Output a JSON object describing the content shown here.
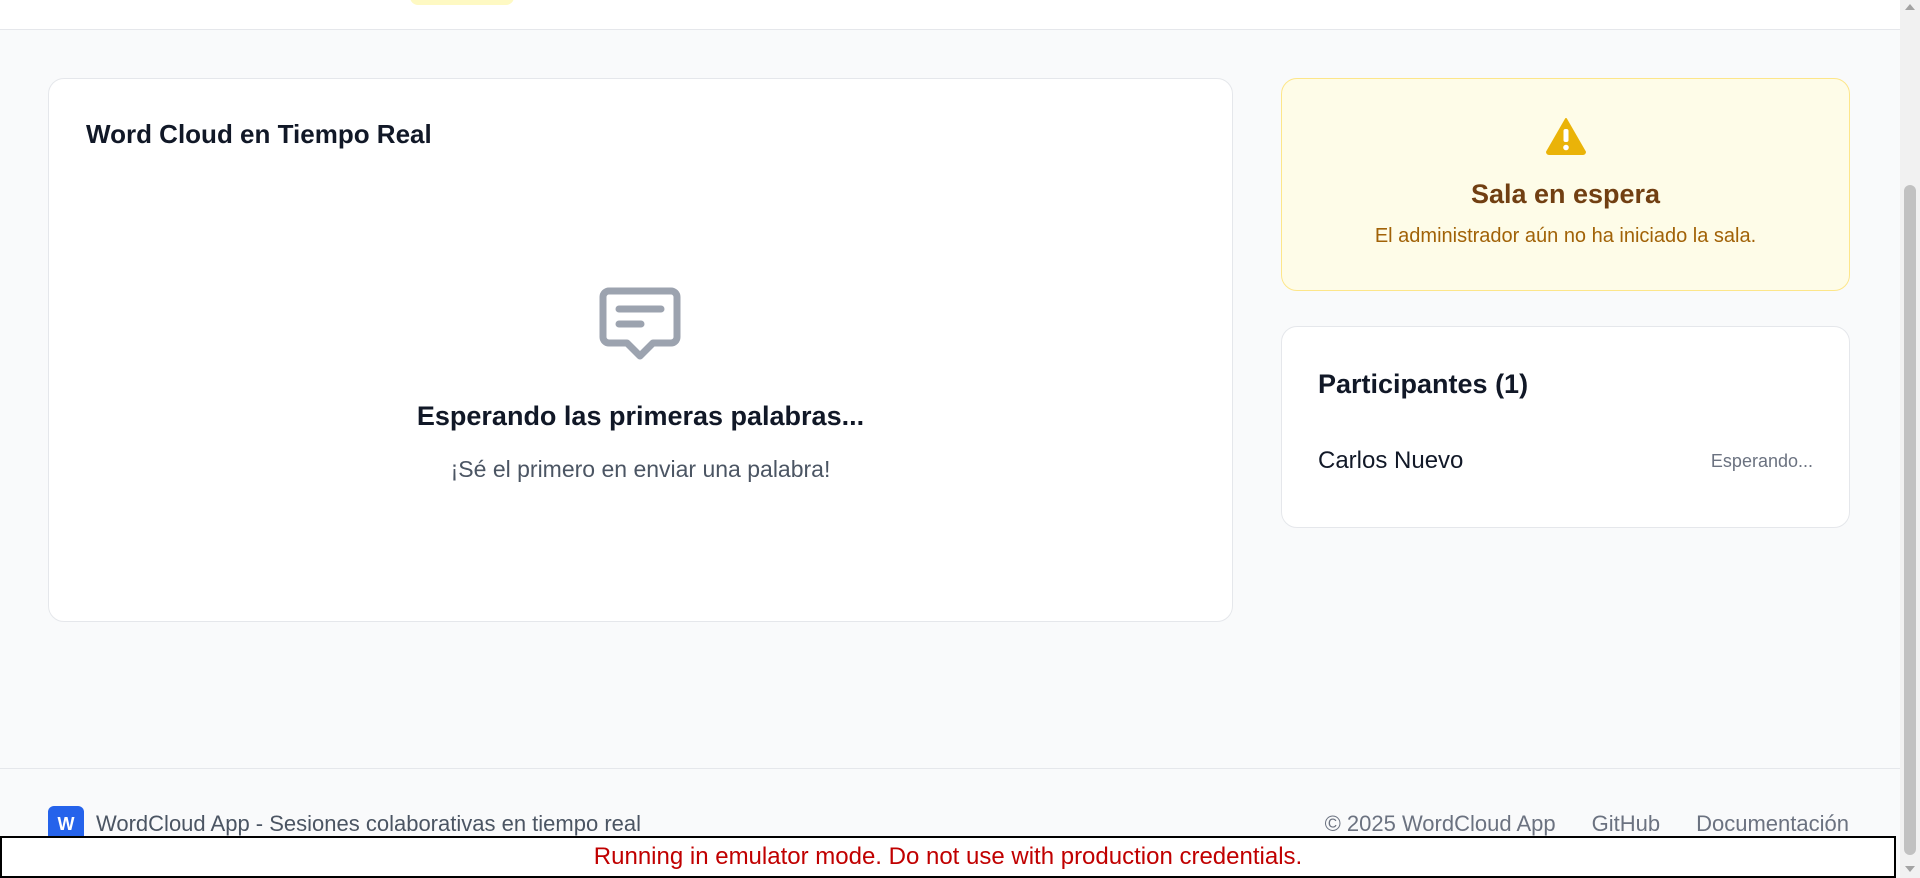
{
  "cloud": {
    "title": "Word Cloud en Tiempo Real",
    "empty_title": "Esperando las primeras palabras...",
    "empty_subtitle": "¡Sé el primero en enviar una palabra!",
    "empty_icon": "message-icon"
  },
  "waiting": {
    "title": "Sala en espera",
    "subtitle": "El administrador aún no ha iniciado la sala.",
    "icon": "warning-icon",
    "accent": "#eab308"
  },
  "participants": {
    "title": "Participantes (1)",
    "items": [
      {
        "name": "Carlos Nuevo",
        "status": "Esperando..."
      }
    ]
  },
  "footer": {
    "logo_letter": "W",
    "app_text": "WordCloud App - Sesiones colaborativas en tiempo real",
    "copyright": "© 2025 WordCloud App",
    "links": [
      "GitHub",
      "Documentación"
    ],
    "brand_color": "#2563eb"
  },
  "banner": {
    "text": "Running in emulator mode. Do not use with production credentials."
  }
}
